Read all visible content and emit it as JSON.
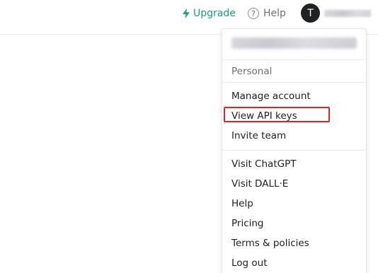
{
  "header": {
    "upgrade_label": "Upgrade",
    "help_label": "Help",
    "avatar_initial": "T",
    "accent_color": "#10a37f"
  },
  "menu": {
    "section_label": "Personal",
    "group1": [
      "Manage account",
      "View API keys",
      "Invite team"
    ],
    "group2": [
      "Visit ChatGPT",
      "Visit DALL·E",
      "Help",
      "Pricing",
      "Terms & policies",
      "Log out"
    ],
    "highlight_color": "#e02424"
  }
}
